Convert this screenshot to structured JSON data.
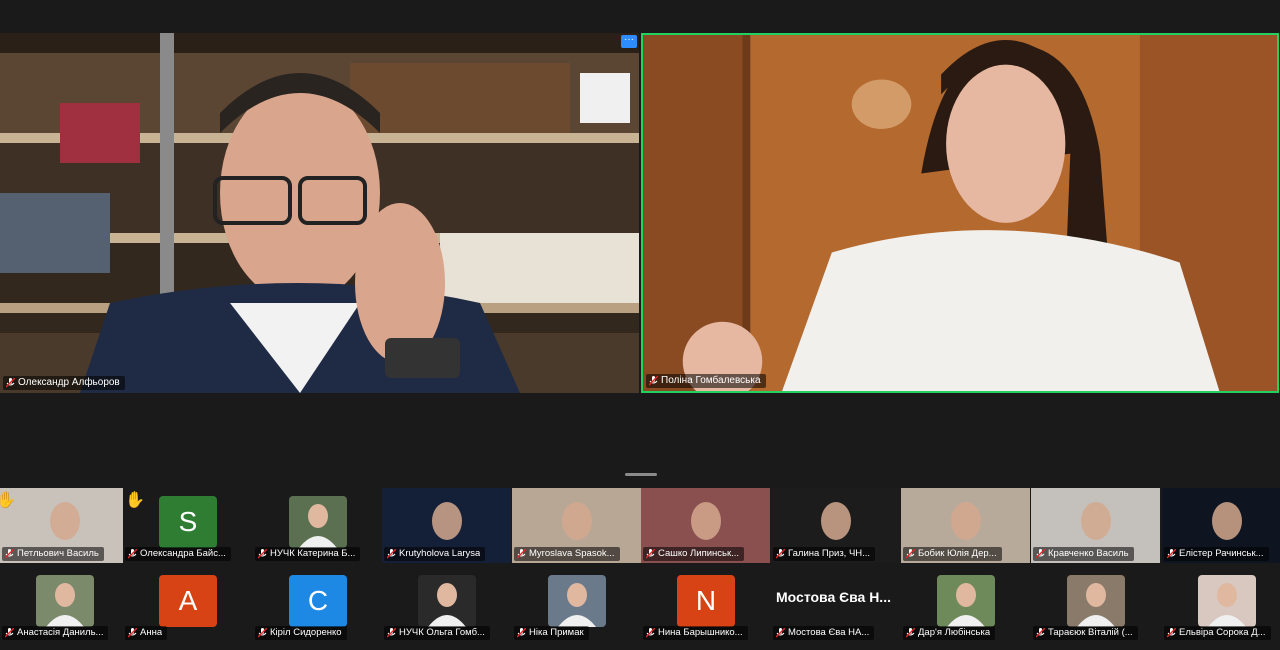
{
  "main_videos": [
    {
      "name": "Олександр Алфьоров",
      "active_speaker": false
    },
    {
      "name": "Поліна Гомбалевська",
      "active_speaker": true
    }
  ],
  "more_button_label": "···",
  "gallery": {
    "row1": [
      {
        "name": "Петльович Василь",
        "type": "video",
        "raised_hand": true
      },
      {
        "name": "Олександра Байс...",
        "type": "letter",
        "letter": "S",
        "color": "#2f7d32",
        "raised_hand": true
      },
      {
        "name": "НУЧК Катерина Б...",
        "type": "photo"
      },
      {
        "name": "Krutyholova Larysa",
        "type": "video"
      },
      {
        "name": "Myroslava Spasok...",
        "type": "video"
      },
      {
        "name": "Сашко Липинськ...",
        "type": "video"
      },
      {
        "name": "Галина Приз, ЧН...",
        "type": "video"
      },
      {
        "name": "Бобик Юлія Дер...",
        "type": "video"
      },
      {
        "name": "Кравченко Василь",
        "type": "video"
      },
      {
        "name": "Елістер Рачинськ...",
        "type": "video"
      }
    ],
    "row2": [
      {
        "name": "Анастасія Даниль...",
        "type": "photo"
      },
      {
        "name": "Анна",
        "type": "letter",
        "letter": "A",
        "color": "#d84315"
      },
      {
        "name": "Кіріл Сидоренко",
        "type": "letter",
        "letter": "C",
        "color": "#1e88e5"
      },
      {
        "name": "НУЧК Ольга Гомб...",
        "type": "photo"
      },
      {
        "name": "Ніка Примак",
        "type": "photo"
      },
      {
        "name": "Нина Барышнико...",
        "type": "letter",
        "letter": "N",
        "color": "#d84315"
      },
      {
        "name": "Мостова Єва НА...",
        "type": "text",
        "big_name": "Мостова Єва Н..."
      },
      {
        "name": "Дар'я Любінська",
        "type": "photo"
      },
      {
        "name": "Тараєюк Віталій (...",
        "type": "photo"
      },
      {
        "name": "Ельвіра Сорока Д...",
        "type": "photo"
      }
    ]
  }
}
